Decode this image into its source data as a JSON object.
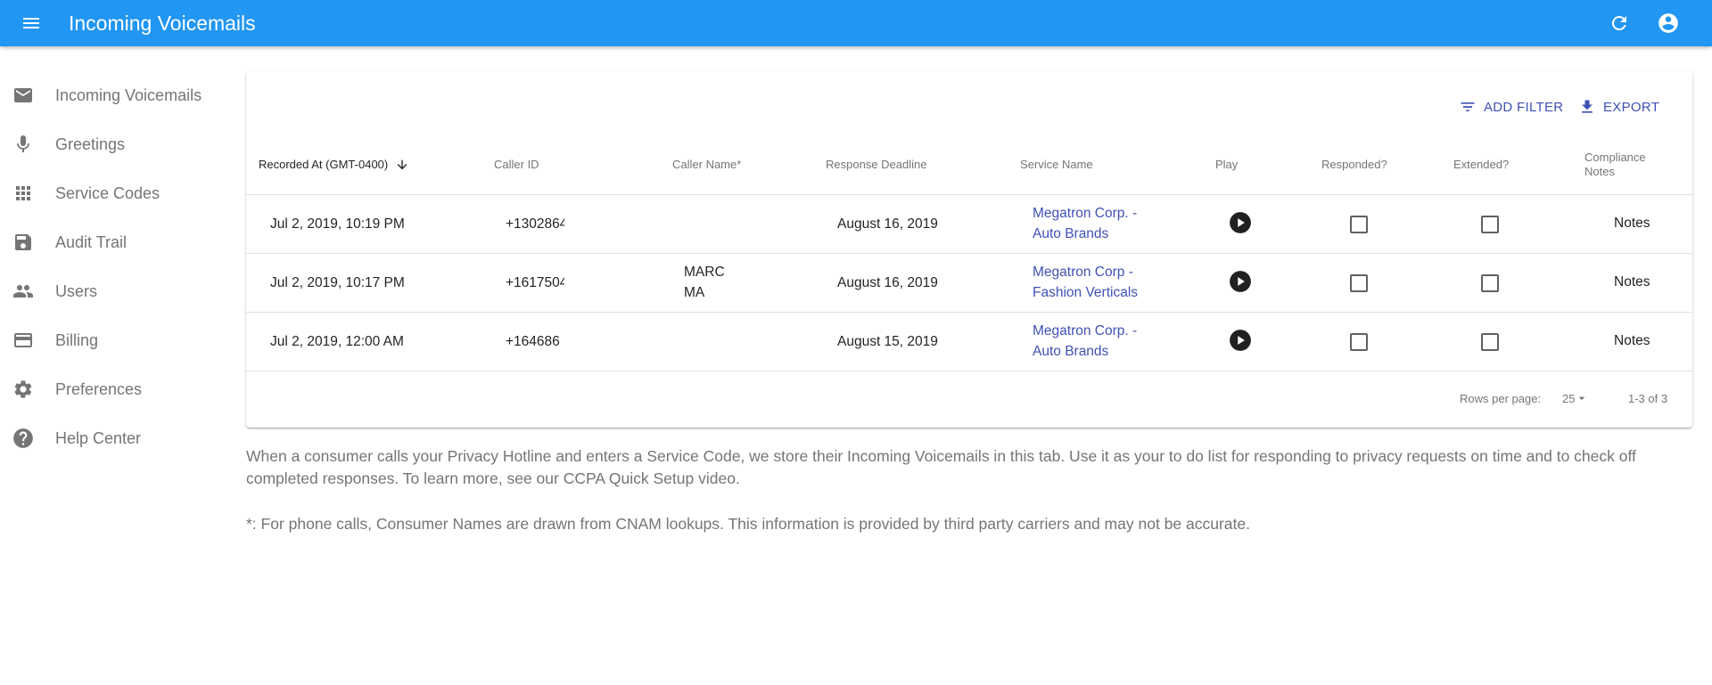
{
  "app": {
    "title": "Incoming Voicemails",
    "accent_color": "#2196f3",
    "link_color": "#3f51b5",
    "icons": {
      "menu": "menu-icon",
      "refresh": "refresh-icon",
      "account": "account-circle-icon"
    }
  },
  "sidebar": {
    "items": [
      {
        "label": "Incoming Voicemails",
        "icon": "mail-icon"
      },
      {
        "label": "Greetings",
        "icon": "microphone-icon"
      },
      {
        "label": "Service Codes",
        "icon": "apps-grid-icon"
      },
      {
        "label": "Audit Trail",
        "icon": "save-icon"
      },
      {
        "label": "Users",
        "icon": "people-icon"
      },
      {
        "label": "Billing",
        "icon": "credit-card-icon"
      },
      {
        "label": "Preferences",
        "icon": "gear-icon"
      },
      {
        "label": "Help Center",
        "icon": "help-circle-icon"
      }
    ]
  },
  "toolbar": {
    "add_filter": "ADD FILTER",
    "export": "EXPORT"
  },
  "table": {
    "columns": {
      "recorded_at": "Recorded At (GMT-0400)",
      "caller_id": "Caller ID",
      "caller_name": "Caller Name*",
      "response_deadline": "Response Deadline",
      "service_name": "Service Name",
      "play": "Play",
      "responded": "Responded?",
      "extended": "Extended?",
      "compliance_notes": "Compliance Notes"
    },
    "sort": {
      "column": "recorded_at",
      "direction": "descending"
    },
    "rows": [
      {
        "recorded_at": "Jul 2, 2019, 10:19 PM",
        "caller_id": "+1302864",
        "caller_name": "",
        "response_deadline": "August 16, 2019",
        "service_name": "Megatron Corp. - Auto Brands",
        "responded": false,
        "extended": false,
        "notes": "Notes"
      },
      {
        "recorded_at": "Jul 2, 2019, 10:17 PM",
        "caller_id": "+1617504",
        "caller_name": "MARC MA",
        "response_deadline": "August 16, 2019",
        "service_name": "Megatron Corp - Fashion Verticals",
        "responded": false,
        "extended": false,
        "notes": "Notes"
      },
      {
        "recorded_at": "Jul 2, 2019, 12:00 AM",
        "caller_id": "+164686",
        "caller_name": "",
        "response_deadline": "August 15, 2019",
        "service_name": "Megatron Corp. - Auto Brands",
        "responded": false,
        "extended": false,
        "notes": "Notes"
      }
    ]
  },
  "pagination": {
    "rows_per_page_label": "Rows per page:",
    "rows_per_page": "25",
    "range": "1-3 of 3"
  },
  "info": {
    "description": "When a consumer calls your Privacy Hotline and enters a Service Code, we store their Incoming Voicemails in this tab. Use it as your to do list for responding to privacy requests on time and to check off completed responses. To learn more, see our CCPA Quick Setup video.",
    "footnote": "*: For phone calls, Consumer Names are drawn from CNAM lookups. This information is provided by third party carriers and may not be accurate."
  }
}
